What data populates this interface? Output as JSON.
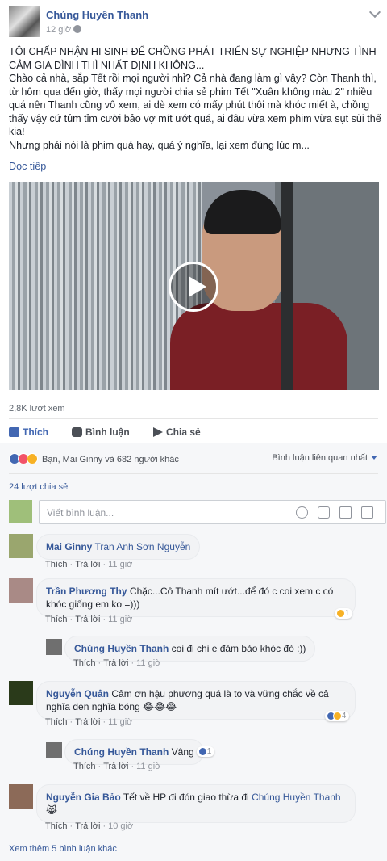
{
  "post": {
    "author": "Chúng Huyền Thanh",
    "time": "12 giờ",
    "paragraphs": [
      "TÔI CHẤP NHẬN HI SINH ĐỂ CHỒNG PHÁT TRIỂN SỰ NGHIỆP NHƯNG TÌNH CẢM GIA ĐÌNH THÌ NHẤT ĐỊNH KHÔNG...",
      "Chào cả nhà, sắp Tết rồi mọi người nhỉ? Cả nhà đang làm gì vậy? Còn Thanh thì, từ hôm qua đến giờ, thấy mọi người chia sẻ phim Tết \"Xuân không màu 2\" nhiều quá nên Thanh cũng vô xem, ai dè xem có mấy phút thôi mà khóc miết à, chồng thấy vậy cứ tủm tỉm cười bảo vợ mít ướt quá, ai đâu vừa xem phim vừa sụt sùi thế kia!",
      "Nhưng phải nói là phim quá hay, quá ý nghĩa, lại xem đúng lúc m..."
    ],
    "read_more": "Đọc tiếp",
    "views": "2,8K lượt xem"
  },
  "actions": {
    "like": "Thích",
    "comment": "Bình luận",
    "share": "Chia sẻ"
  },
  "summary": {
    "reactions_text": "Bạn, Mai Ginny và 682 người khác",
    "sort_label": "Bình luận liên quan nhất",
    "shares": "24 lượt chia sẻ",
    "write_placeholder": "Viết bình luận..."
  },
  "comments": [
    {
      "name": "Mai Ginny",
      "text": "",
      "tag": "Tran Anh Sơn Nguyễn",
      "like": "Thích",
      "reply": "Trả lời",
      "time": "11 giờ"
    },
    {
      "name": "Trần Phương Thy",
      "text": "Chặc...Cô Thanh mít ướt...để đó c coi xem c có khóc giống em ko =)))",
      "like": "Thích",
      "reply": "Trả lời",
      "time": "11 giờ",
      "reaction_count": "1"
    },
    {
      "name": "Chúng Huyền Thanh",
      "text": "coi đi chị e đảm bảo khóc đó :))",
      "like": "Thích",
      "reply": "Trả lời",
      "time": "11 giờ"
    },
    {
      "name": "Nguyễn Quân",
      "text": "Cảm ơn hậu phương quá là to và vững chắc về cả nghĩa đen nghĩa bóng 😂😂😂",
      "like": "Thích",
      "reply": "Trả lời",
      "time": "11 giờ",
      "reaction_count": "4"
    },
    {
      "name": "Chúng Huyền Thanh",
      "text": "Vâng",
      "like": "Thích",
      "reply": "Trả lời",
      "time": "11 giờ",
      "reaction_count": "1"
    },
    {
      "name": "Nguyễn Gia Bảo",
      "text": "Tết về HP đi đón giao thừa đi",
      "tag": "Chúng Huyền Thanh",
      "emoji": "😹",
      "like": "Thích",
      "reply": "Trả lời",
      "time": "10 giờ"
    }
  ],
  "more_comments": "Xem thêm 5 bình luận khác"
}
